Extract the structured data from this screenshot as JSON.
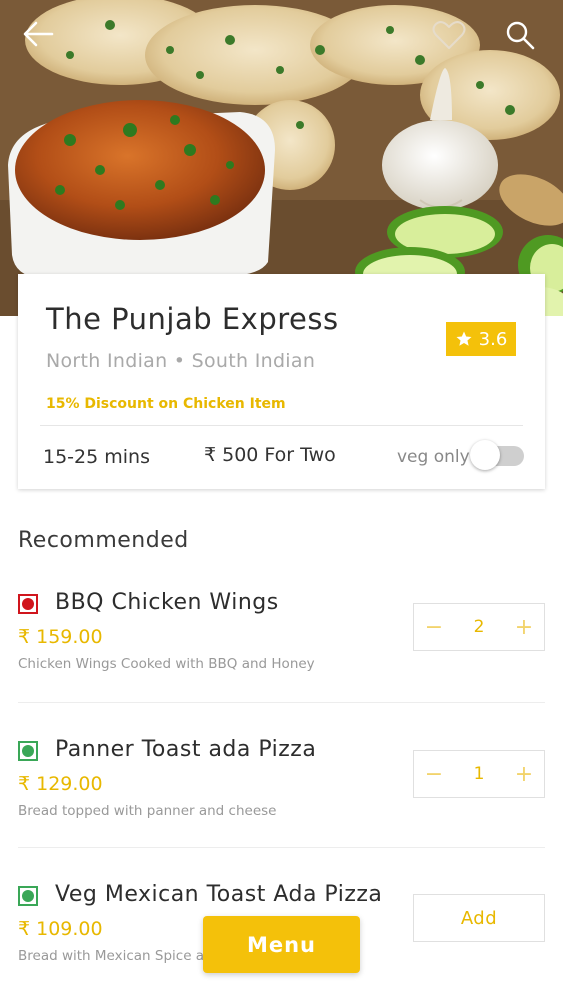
{
  "header": {
    "back_icon": "back-arrow-icon",
    "favorite_icon": "heart-icon",
    "search_icon": "search-icon"
  },
  "restaurant": {
    "name": "The Punjab Express",
    "cuisines": "North Indian • South Indian",
    "rating": "3.6",
    "offer": "15% Discount on Chicken Item",
    "delivery_time": "15-25 mins",
    "cost_for_two": "₹ 500 For Two",
    "veg_only_label": "veg only",
    "veg_only_enabled": false
  },
  "section_title": "Recommended",
  "items": [
    {
      "type": "non-veg",
      "name": "BBQ Chicken Wings",
      "price": "₹ 159.00",
      "description": "Chicken Wings Cooked with BBQ and Honey",
      "quantity": "2",
      "minus": "−",
      "plus": "+"
    },
    {
      "type": "veg",
      "name": "Panner Toast ada Pizza",
      "price": "₹ 129.00",
      "description": "Bread topped with panner and cheese",
      "quantity": "1",
      "minus": "−",
      "plus": "+"
    },
    {
      "type": "veg",
      "name": "Veg Mexican Toast Ada Pizza",
      "price": "₹ 109.00",
      "description": "Bread with Mexican Spice a",
      "add_label": "Add"
    }
  ],
  "menu_button": "Menu",
  "colors": {
    "accent": "#f4c10a",
    "veg": "#3aa757",
    "non_veg": "#d0151d"
  }
}
